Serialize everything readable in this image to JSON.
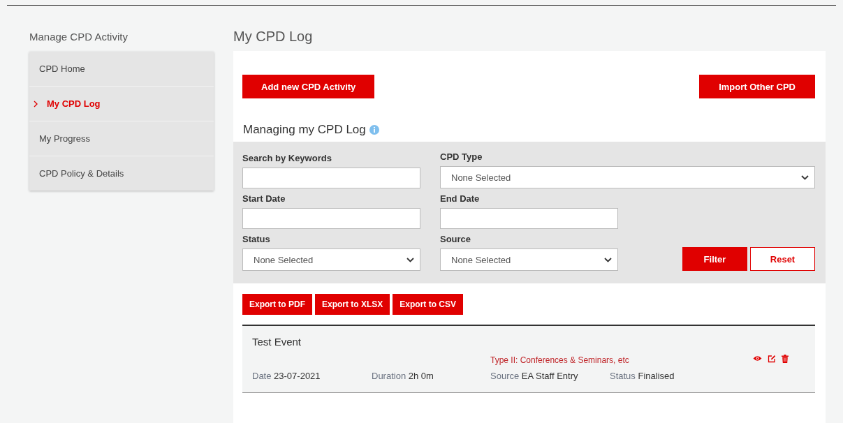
{
  "sidebar": {
    "heading": "Manage CPD Activity",
    "items": [
      {
        "label": "CPD Home",
        "selected": false
      },
      {
        "label": "My CPD Log",
        "selected": true
      },
      {
        "label": "My Progress",
        "selected": false
      },
      {
        "label": "CPD Policy & Details",
        "selected": false
      }
    ]
  },
  "page_title": "My CPD Log",
  "top_buttons": [
    "Add new CPD Activity",
    "Import Other CPD"
  ],
  "section_title": "Managing my CPD Log",
  "filters": {
    "keywords": {
      "label": "Search by Keywords"
    },
    "cpd_type": {
      "label": "CPD Type",
      "value": "None Selected"
    },
    "start_date": {
      "label": "Start Date"
    },
    "end_date": {
      "label": "End Date"
    },
    "status": {
      "label": "Status",
      "value": "None Selected"
    },
    "source": {
      "label": "Source",
      "value": "None Selected"
    },
    "buttons": [
      {
        "label": "Filter",
        "kind": "primary"
      },
      {
        "label": "Reset",
        "kind": "outline"
      }
    ]
  },
  "export_buttons": [
    "Export to PDF",
    "Export to XLSX",
    "Export to CSV"
  ],
  "records": [
    {
      "title": "Test Event",
      "type": "Type II: Conferences & Seminars, etc",
      "meta": [
        {
          "label": "Date",
          "value": "23-07-2021"
        },
        {
          "label": "Duration",
          "value": "2h 0m"
        },
        {
          "label": "Source",
          "value": "EA Staff Entry"
        },
        {
          "label": "Status",
          "value": "Finalised"
        }
      ]
    }
  ]
}
